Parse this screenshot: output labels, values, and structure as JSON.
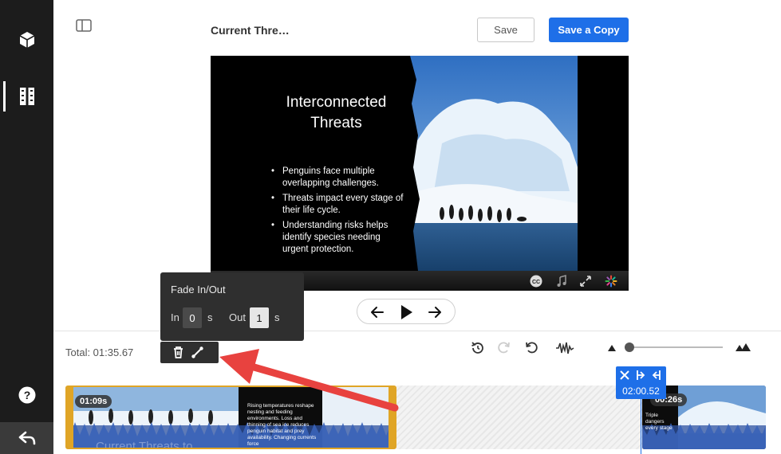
{
  "header": {
    "title": "Current Thre…",
    "save_label": "Save",
    "save_copy_label": "Save a Copy"
  },
  "slide": {
    "title_line1": "Interconnected",
    "title_line2": "Threats",
    "bullets": [
      "Penguins face multiple overlapping challenges.",
      "Threats impact every stage of their life cycle.",
      "Understanding risks helps identify species needing urgent protection."
    ]
  },
  "player_bar": {
    "icons": [
      "closed-captions-icon",
      "music-note-icon",
      "fullscreen-icon",
      "loading-spinner-icon"
    ]
  },
  "fade_popup": {
    "title": "Fade In/Out",
    "in_label": "In",
    "in_value": "0",
    "in_unit": "s",
    "out_label": "Out",
    "out_value": "1",
    "out_unit": "s"
  },
  "timeline": {
    "total_label": "Total: 01:35.67",
    "clip1_duration": "01:09s",
    "clip1_caption": "Current Threats to",
    "clip1_slidetext": "Rising temperatures reshape nesting and feeding environments. Loss and thinning of sea ice reduces penguin habitat and prey availability. Changing currents force",
    "clip2_duration": "00:26s",
    "clip2_slidetext": "Triple dangers every stage",
    "playhead_time": "02:00.52"
  },
  "colors": {
    "accent": "#1e6fe8",
    "clip_selected_border": "#e0a526",
    "annotation_arrow": "#e8423f",
    "rail": "#1c1c1c"
  }
}
